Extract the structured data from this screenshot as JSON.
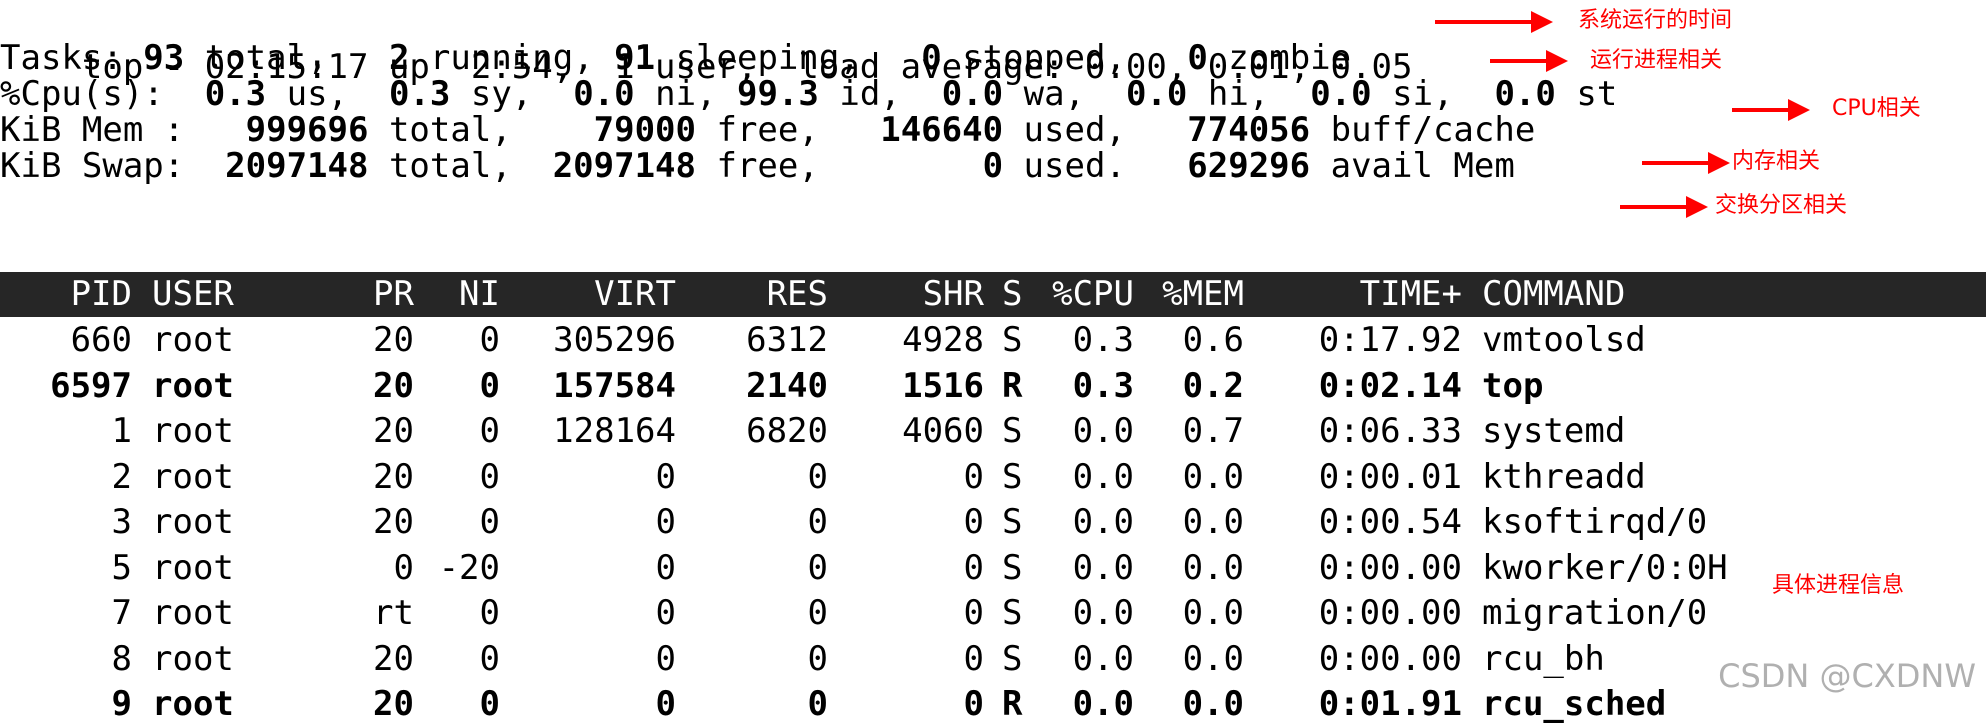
{
  "summary": {
    "line1": "top - 02:15:17 up  2:54,  1 user,  load average: 0.00, 0.01, 0.05",
    "tasks": {
      "lead": "Tasks: ",
      "total": "93",
      "total_lbl": " total,   ",
      "running": "2",
      "running_lbl": " running, ",
      "sleeping": "91",
      "sleeping_lbl": " sleeping,   ",
      "stopped": "0",
      "stopped_lbl": " stopped,   ",
      "zombie": "0",
      "zombie_lbl": " zombie"
    },
    "cpu": {
      "lead": "%Cpu(s):  ",
      "us": "0.3",
      "us_lbl": " us,  ",
      "sy": "0.3",
      "sy_lbl": " sy,  ",
      "ni": "0.0",
      "ni_lbl": " ni, ",
      "id": "99.3",
      "id_lbl": " id,  ",
      "wa": "0.0",
      "wa_lbl": " wa,  ",
      "hi": "0.0",
      "hi_lbl": " hi,  ",
      "si": "0.0",
      "si_lbl": " si,  ",
      "st": "0.0",
      "st_lbl": " st"
    },
    "mem": {
      "lead": "KiB Mem :   ",
      "total": "999696",
      "total_lbl": " total,    ",
      "free": "79000",
      "free_lbl": " free,   ",
      "used": "146640",
      "used_lbl": " used,   ",
      "cache": "774056",
      "cache_lbl": " buff/cache"
    },
    "swap": {
      "lead": "KiB Swap:  ",
      "total": "2097148",
      "total_lbl": " total,  ",
      "free": "2097148",
      "free_lbl": " free,        ",
      "used": "0",
      "used_lbl": " used.   ",
      "avail": "629296",
      "avail_lbl": " avail Mem"
    }
  },
  "columns": {
    "pid": "PID",
    "user": "USER",
    "pr": "PR",
    "ni": "NI",
    "virt": "VIRT",
    "res": "RES",
    "shr": "SHR",
    "s": "S",
    "cpu": "%CPU",
    "mem": "%MEM",
    "time": "TIME+",
    "command": "COMMAND"
  },
  "processes": [
    {
      "pid": "660",
      "user": "root",
      "pr": "20",
      "ni": "0",
      "virt": "305296",
      "res": "6312",
      "shr": "4928",
      "s": "S",
      "cpu": "0.3",
      "mem": "0.6",
      "time": "0:17.92",
      "command": "vmtoolsd",
      "bold": false
    },
    {
      "pid": "6597",
      "user": "root",
      "pr": "20",
      "ni": "0",
      "virt": "157584",
      "res": "2140",
      "shr": "1516",
      "s": "R",
      "cpu": "0.3",
      "mem": "0.2",
      "time": "0:02.14",
      "command": "top",
      "bold": true
    },
    {
      "pid": "1",
      "user": "root",
      "pr": "20",
      "ni": "0",
      "virt": "128164",
      "res": "6820",
      "shr": "4060",
      "s": "S",
      "cpu": "0.0",
      "mem": "0.7",
      "time": "0:06.33",
      "command": "systemd",
      "bold": false
    },
    {
      "pid": "2",
      "user": "root",
      "pr": "20",
      "ni": "0",
      "virt": "0",
      "res": "0",
      "shr": "0",
      "s": "S",
      "cpu": "0.0",
      "mem": "0.0",
      "time": "0:00.01",
      "command": "kthreadd",
      "bold": false
    },
    {
      "pid": "3",
      "user": "root",
      "pr": "20",
      "ni": "0",
      "virt": "0",
      "res": "0",
      "shr": "0",
      "s": "S",
      "cpu": "0.0",
      "mem": "0.0",
      "time": "0:00.54",
      "command": "ksoftirqd/0",
      "bold": false
    },
    {
      "pid": "5",
      "user": "root",
      "pr": "0",
      "ni": "-20",
      "virt": "0",
      "res": "0",
      "shr": "0",
      "s": "S",
      "cpu": "0.0",
      "mem": "0.0",
      "time": "0:00.00",
      "command": "kworker/0:0H",
      "bold": false
    },
    {
      "pid": "7",
      "user": "root",
      "pr": "rt",
      "ni": "0",
      "virt": "0",
      "res": "0",
      "shr": "0",
      "s": "S",
      "cpu": "0.0",
      "mem": "0.0",
      "time": "0:00.00",
      "command": "migration/0",
      "bold": false
    },
    {
      "pid": "8",
      "user": "root",
      "pr": "20",
      "ni": "0",
      "virt": "0",
      "res": "0",
      "shr": "0",
      "s": "S",
      "cpu": "0.0",
      "mem": "0.0",
      "time": "0:00.00",
      "command": "rcu_bh",
      "bold": false
    },
    {
      "pid": "9",
      "user": "root",
      "pr": "20",
      "ni": "0",
      "virt": "0",
      "res": "0",
      "shr": "0",
      "s": "R",
      "cpu": "0.0",
      "mem": "0.0",
      "time": "0:01.91",
      "command": "rcu_sched",
      "bold": true
    }
  ],
  "annotations": {
    "uptime": "系统运行的时间",
    "tasks": "运行进程相关",
    "cpu": "CPU相关",
    "mem": "内存相关",
    "swap": "交换分区相关",
    "processes": "具体进程信息"
  },
  "watermark": "CSDN @CXDNW",
  "colors": {
    "header_bg": "#262626",
    "annotation": "#ff0000",
    "watermark": "#b0b0b0"
  }
}
